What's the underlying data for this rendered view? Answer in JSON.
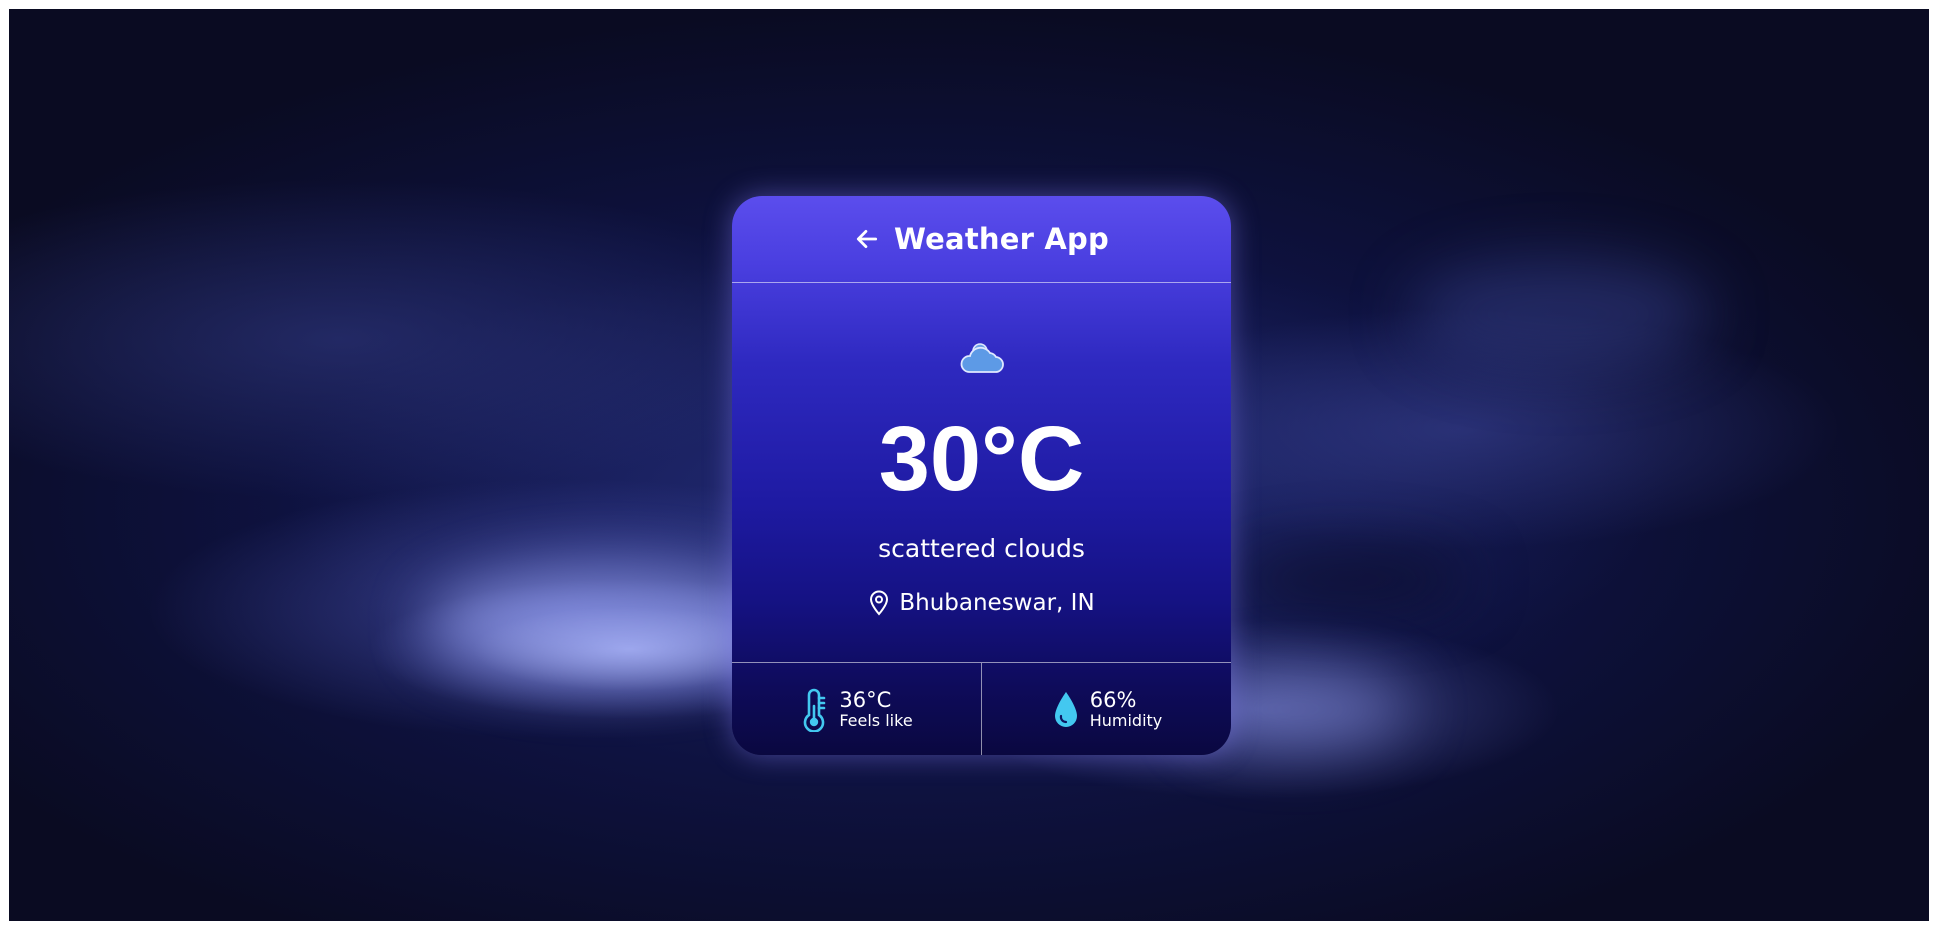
{
  "header": {
    "title": "Weather App",
    "back_icon": "arrow-left-icon"
  },
  "current": {
    "condition_icon": "cloud-icon",
    "temperature": "30°C",
    "description": "scattered clouds",
    "location_icon": "map-pin-icon",
    "location": "Bhubaneswar, IN"
  },
  "stats": {
    "feels_like": {
      "icon": "thermometer-icon",
      "value": "36°C",
      "label": "Feels like"
    },
    "humidity": {
      "icon": "droplet-icon",
      "value": "66%",
      "label": "Humidity"
    }
  },
  "colors": {
    "card_top": "#5b4ded",
    "card_bottom": "#0a0840",
    "accent_icon": "#43c8f0",
    "text": "#ffffff"
  }
}
